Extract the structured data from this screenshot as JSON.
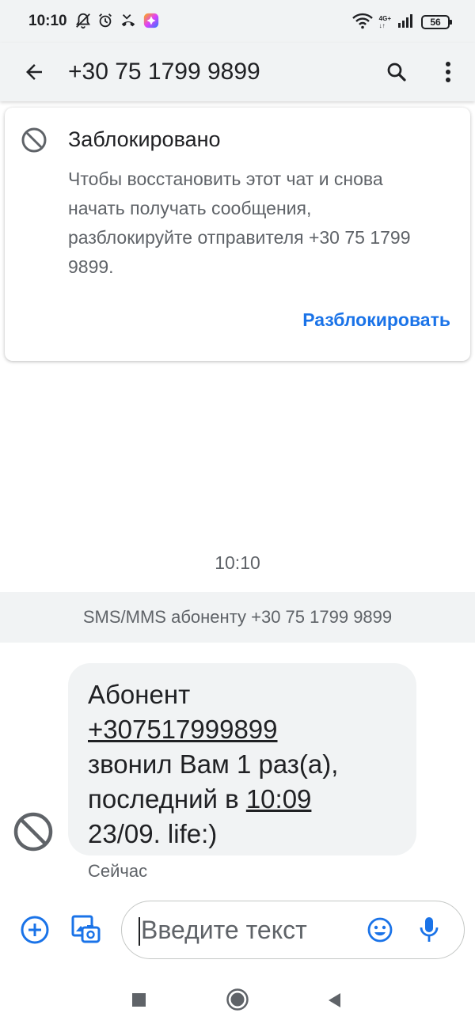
{
  "status_bar": {
    "time": "10:10",
    "network_label_top": "4G+",
    "network_label_bottom": "↓↑",
    "battery_level": "56"
  },
  "app_bar": {
    "title": "+30 75 1799 9899",
    "icons": [
      "back-arrow-icon",
      "search-icon",
      "more-vert-icon"
    ]
  },
  "blocked_card": {
    "title": "Заблокировано",
    "description": "Чтобы восстановить этот чат и снова начать получать сообщения, разблокируйте отправителя +30 75 1799 9899.",
    "unblock_label": "Разблокировать"
  },
  "conversation": {
    "timestamp": "10:10",
    "sms_banner": "SMS/MMS абоненту +30 75 1799 9899",
    "message": {
      "line1": "Абонент",
      "phone": "+307517999899",
      "line3": "звонил Вам 1 раз(а),",
      "line4_prefix": "последний в ",
      "time_link": "10:09",
      "line5": "23/09. life:)"
    },
    "message_time": "Сейчас"
  },
  "compose": {
    "placeholder": "Введите текст"
  },
  "colors": {
    "accent": "#1a73e8",
    "bar_background": "#f1f3f4",
    "bubble_background": "#f1f3f4",
    "secondary_text": "#5f6368"
  }
}
